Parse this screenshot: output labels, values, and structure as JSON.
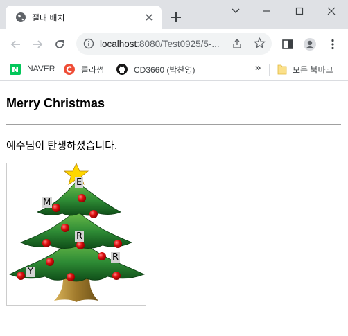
{
  "browser": {
    "tab": {
      "title": "절대 배치"
    },
    "address_bar": {
      "host": "localhost",
      "rest": ":8080/Test0925/5-..."
    },
    "bookmarks": [
      {
        "label": "NAVER",
        "icon": "naver-icon"
      },
      {
        "label": "클라썸",
        "icon": "classum-icon"
      },
      {
        "label": "CD3660 (박찬영)",
        "icon": "github-icon"
      }
    ],
    "overflow_label": "»",
    "all_bookmarks_label": "모든 북마크"
  },
  "page": {
    "heading": "Merry Christmas",
    "paragraph": "예수님이 탄생하셨습니다.",
    "letters": [
      "E",
      "M",
      "R",
      "R",
      "Y"
    ]
  },
  "colors": {
    "tabstrip": "#dfe1e5",
    "tree_green": "#2e8b35",
    "ornament_red": "#e01010",
    "star_yellow": "#ffd700",
    "trunk_brown": "#a07a2c"
  }
}
